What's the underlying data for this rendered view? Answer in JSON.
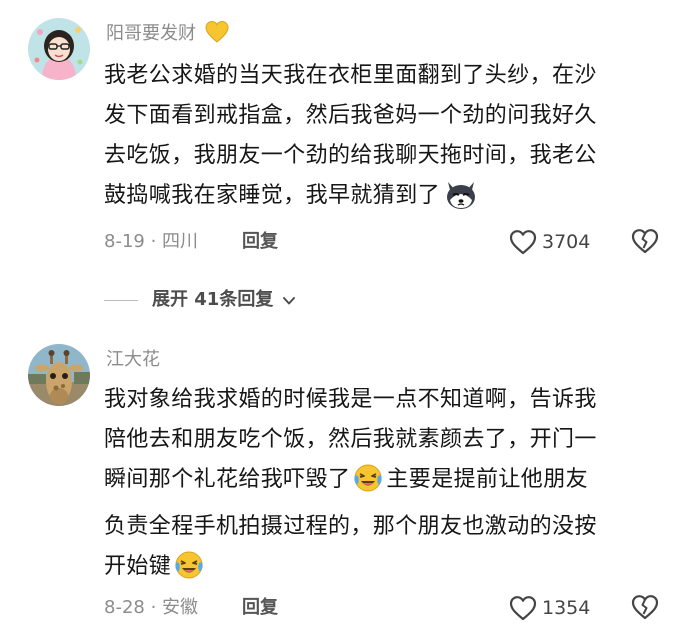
{
  "comments": [
    {
      "username": "阳哥要发财",
      "text_lines": [
        "我老公求婚的当天我在衣柜里面翻到了头纱，在沙",
        "发下面看到戒指盒，然后我爸妈一个劲的问我好久",
        "去吃饭，我朋友一个劲的给我聊天拖时间，我老公",
        "鼓捣喊我在家睡觉，我早就猜到了"
      ],
      "meta": "8-19 · 四川",
      "reply_label": "回复",
      "likes": "3704"
    },
    {
      "username": "江大花",
      "text_lines": [
        "我对象给我求婚的时候我是一点不知道啊，告诉我",
        "陪他去和朋友吃个饭，然后我就素颜去了，开门一",
        "瞬间那个礼花给我吓毁了",
        "主要是提前让他朋友",
        "负责全程手机拍摄过程的，那个朋友也激动的没按",
        "开始键"
      ],
      "meta": "8-28 · 安徽",
      "reply_label": "回复",
      "likes": "1354"
    }
  ],
  "expand_replies": "展开 41条回复",
  "icons": {
    "heart": "heart-outline-icon",
    "dislike": "broken-heart-icon",
    "chevron": "chevron-down-icon"
  },
  "colors": {
    "meta_gray": "#8c8c8c",
    "text": "#161616",
    "emoji_yellow": "#f7c531",
    "tear_blue": "#5aa9e6"
  }
}
